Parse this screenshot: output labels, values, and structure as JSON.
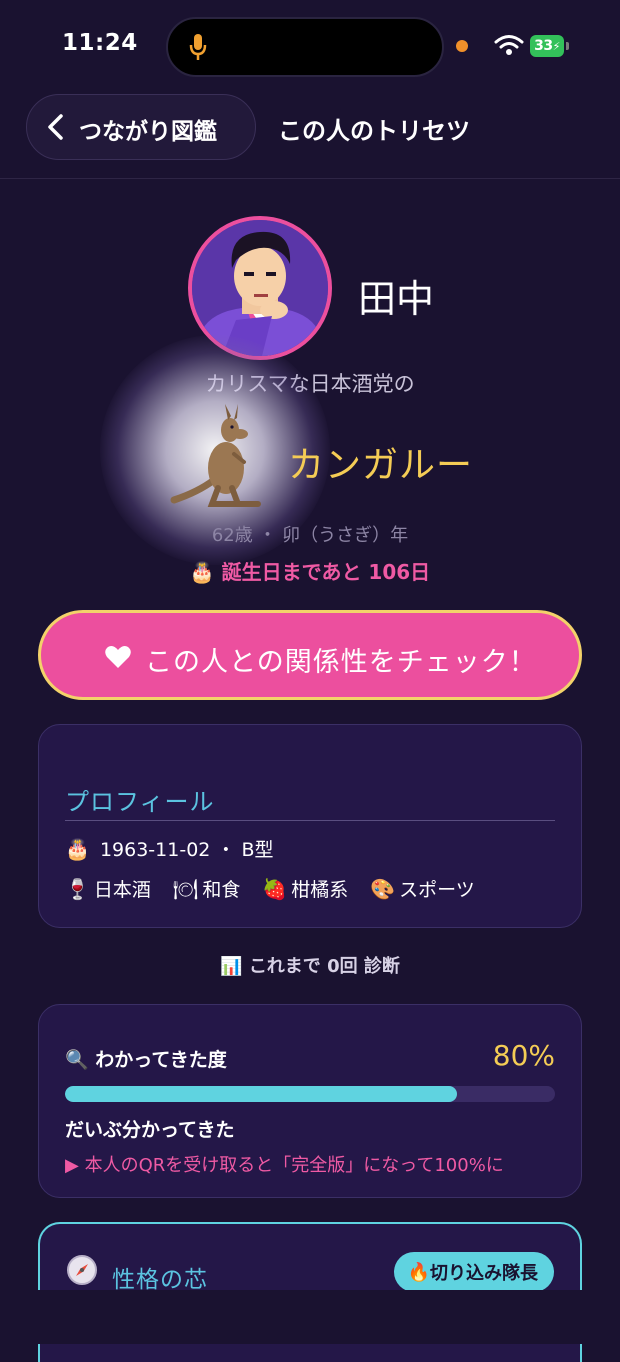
{
  "status_bar": {
    "time": "11:24",
    "battery": "33"
  },
  "nav": {
    "back_label": "つながり図鑑",
    "title": "この人のトリセツ"
  },
  "person": {
    "name": "田中",
    "subtitle": "カリスマな日本酒党の",
    "animal": "カンガルー",
    "age_line": "62歳 ・ 卯（うさぎ）年",
    "birthday_countdown": "誕生日まであと 106日"
  },
  "cta": {
    "label": "この人との関係性をチェック！"
  },
  "profile": {
    "heading": "プロフィール",
    "birth_blood": "1963-11-02 ・ B型",
    "preferences": [
      {
        "icon": "wine-glass-icon",
        "label": "日本酒"
      },
      {
        "icon": "plate-icon",
        "label": "和食"
      },
      {
        "icon": "strawberry-icon",
        "label": "柑橘系"
      },
      {
        "icon": "palette-icon",
        "label": "スポーツ"
      }
    ]
  },
  "diagnosis_count": "これまで 0回 診断",
  "understanding": {
    "title": "わかってきた度",
    "percent_label": "80%",
    "percent": 80,
    "status": "だいぶ分かってきた",
    "hint": "▶ 本人のQRを受け取ると「完全版」になって100%に"
  },
  "core": {
    "title": "性格の芯",
    "badge": "切り込み隊長"
  },
  "colors": {
    "background": "#1a1230",
    "accent_pink": "#ec4f9e",
    "accent_cyan": "#5fd3e0",
    "accent_yellow": "#f4cc55"
  }
}
